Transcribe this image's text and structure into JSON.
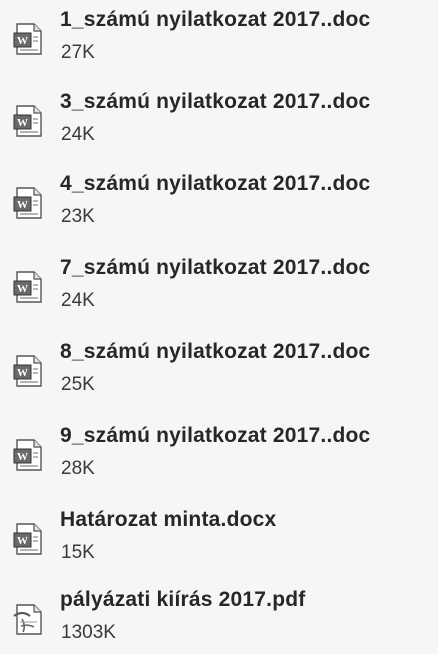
{
  "files": [
    {
      "name": "1_számú nyilatkozat 2017..doc",
      "size": "27K",
      "icon": "word-document-icon"
    },
    {
      "name": "3_számú nyilatkozat 2017..doc",
      "size": "24K",
      "icon": "word-document-icon"
    },
    {
      "name": "4_számú nyilatkozat 2017..doc",
      "size": "23K",
      "icon": "word-document-icon"
    },
    {
      "name": "7_számú nyilatkozat 2017..doc",
      "size": "24K",
      "icon": "word-document-icon"
    },
    {
      "name": "8_számú nyilatkozat 2017..doc",
      "size": "25K",
      "icon": "word-document-icon"
    },
    {
      "name": "9_számú nyilatkozat 2017..doc",
      "size": "28K",
      "icon": "word-document-icon"
    },
    {
      "name": "Határozat minta.docx",
      "size": "15K",
      "icon": "word-document-icon"
    },
    {
      "name": "pályázati kiírás 2017.pdf",
      "size": "1303K",
      "icon": "pdf-document-icon"
    }
  ]
}
